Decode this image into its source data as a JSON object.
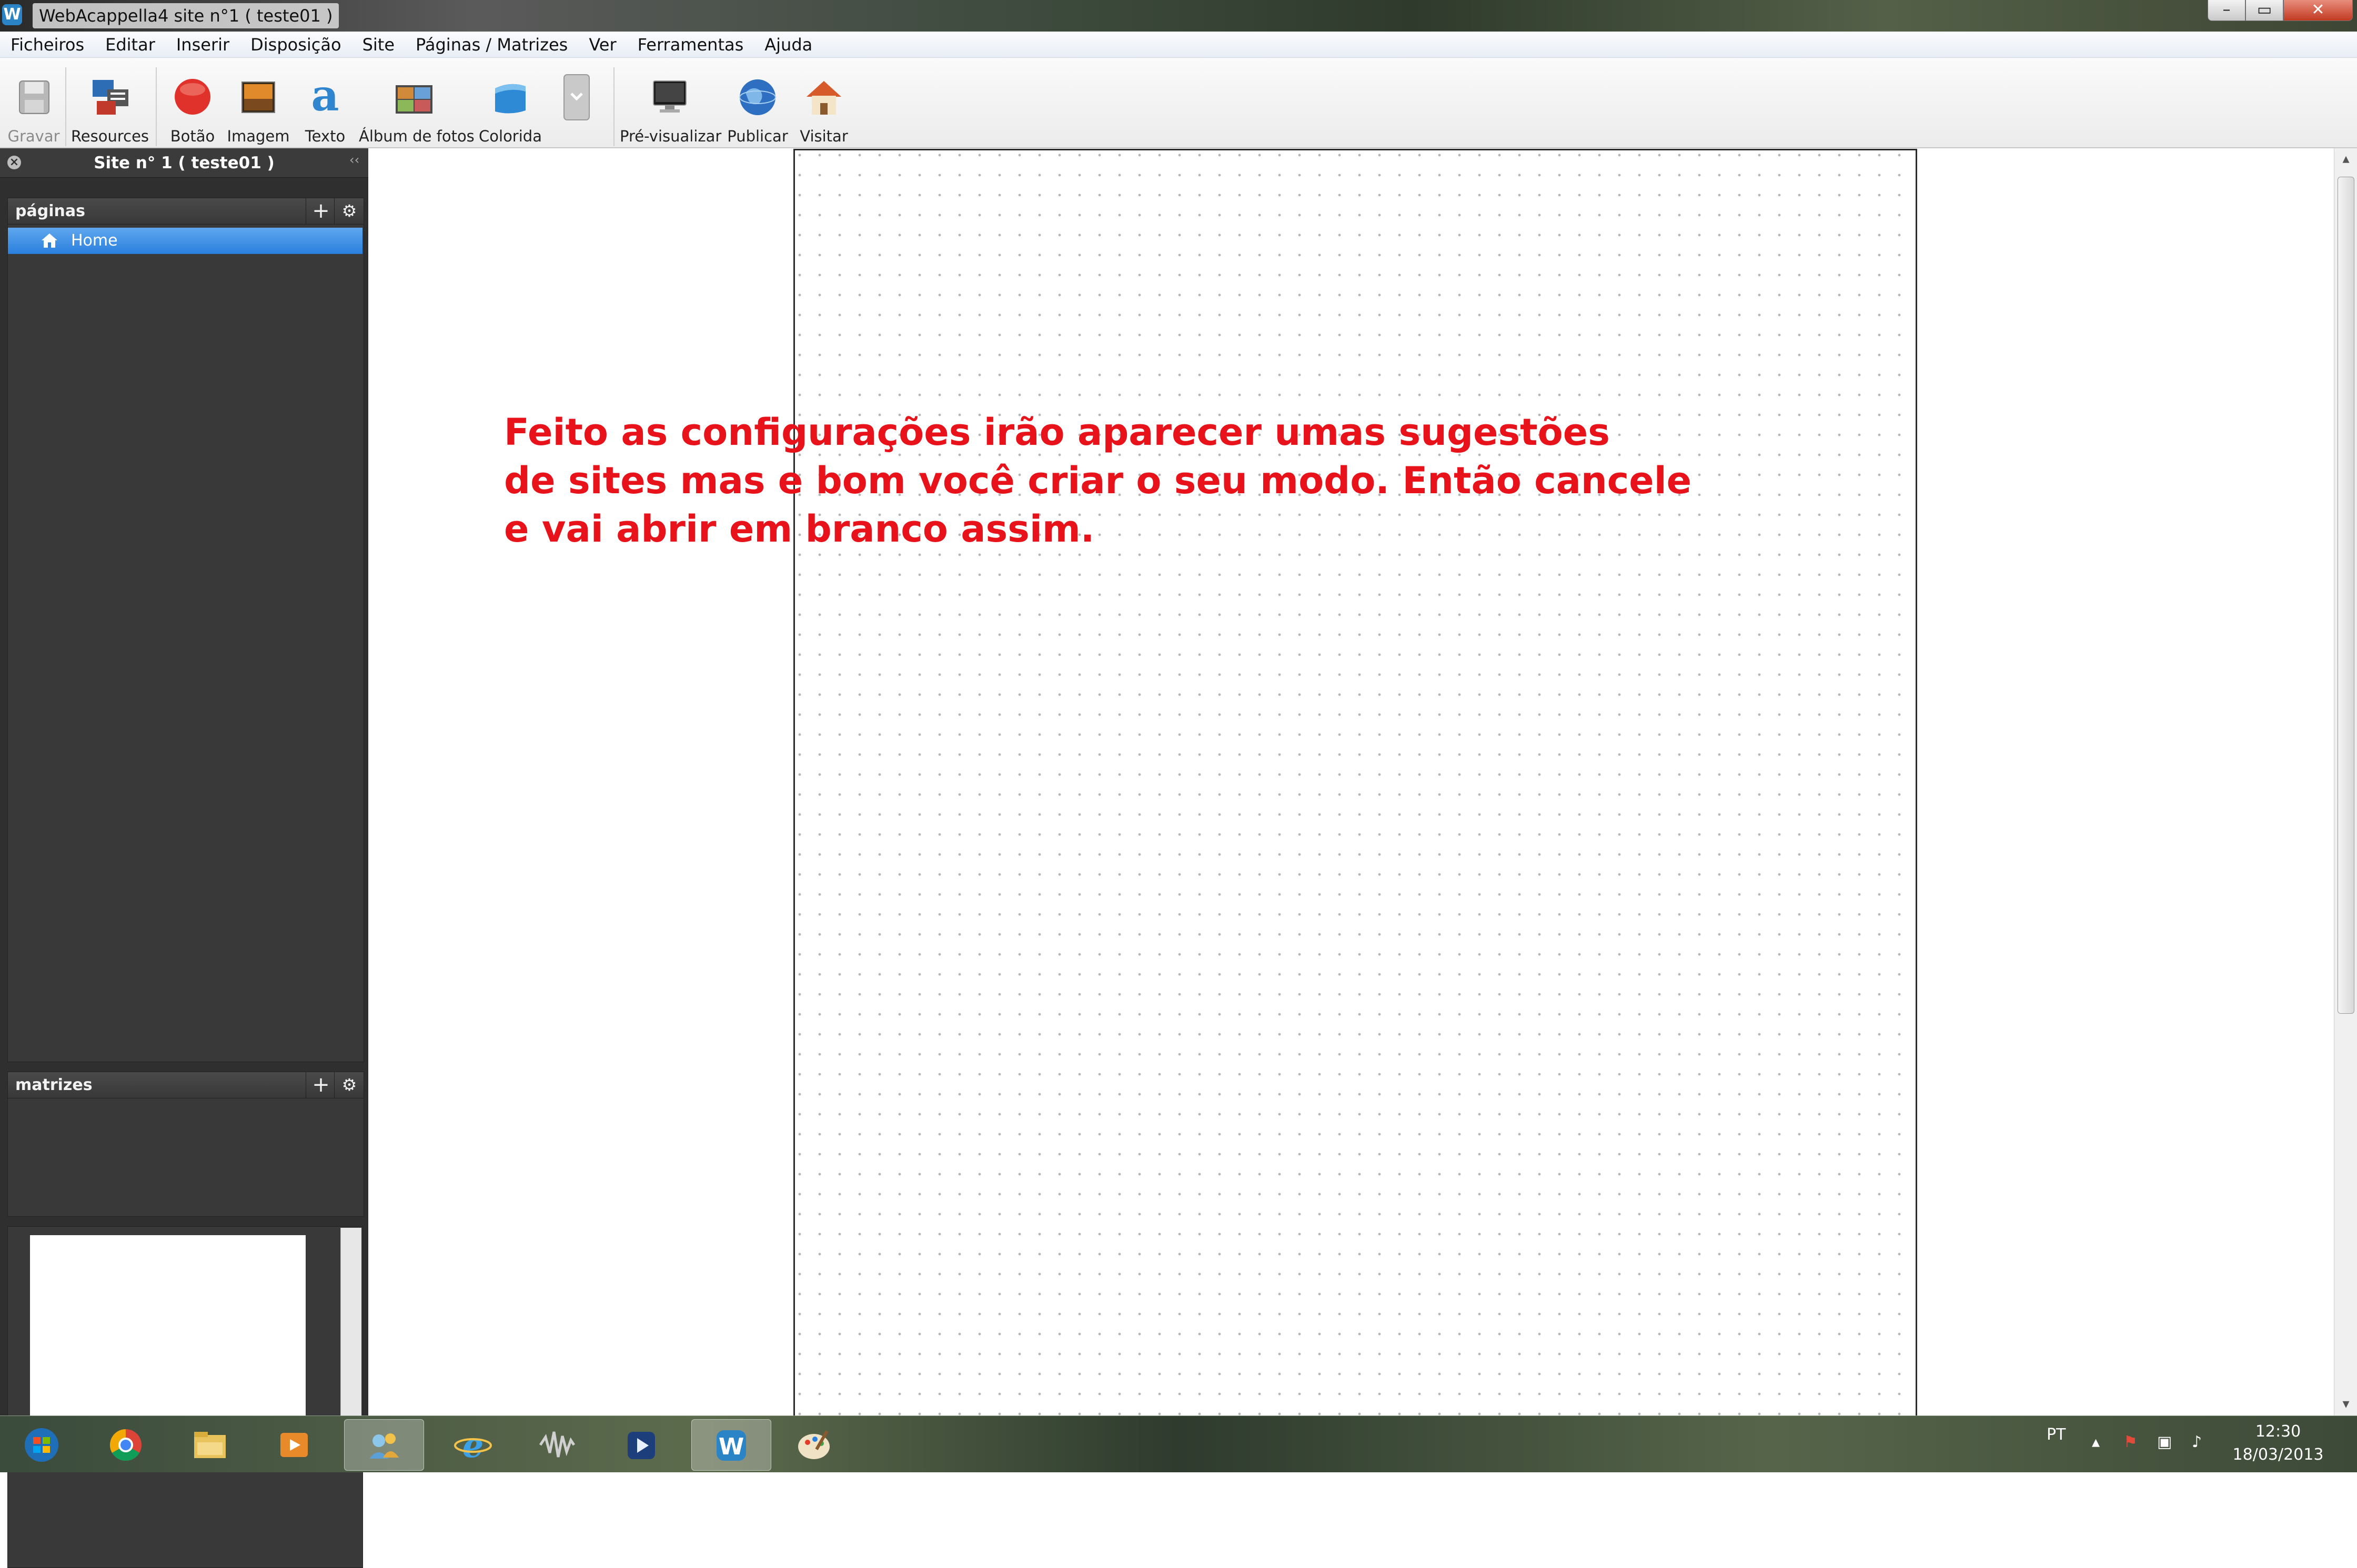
{
  "window": {
    "title": "WebAcappella4 site n°1 ( teste01 )"
  },
  "menu": [
    "Ficheiros",
    "Editar",
    "Inserir",
    "Disposição",
    "Site",
    "Páginas / Matrizes",
    "Ver",
    "Ferramentas",
    "Ajuda"
  ],
  "toolbar": {
    "gravar": "Gravar",
    "resources": "Resources",
    "botao": "Botão",
    "imagem": "Imagem",
    "texto": "Texto",
    "album": "Álbum de fotos",
    "colorida": "Colorida",
    "previsualizar": "Pré-visualizar",
    "publicar": "Publicar",
    "visitar": "Visitar"
  },
  "sidebar": {
    "site_title": "Site n° 1 ( teste01 )",
    "pages_label": "páginas",
    "pages": [
      {
        "label": "Home",
        "selected": true
      }
    ],
    "matrices_label": "matrizes"
  },
  "annotation": {
    "lines": [
      "Feito as configurações irão aparecer umas sugestões",
      "de sites mas e bom você criar o seu modo. Então cancele",
      "e vai abrir em branco assim."
    ],
    "color": "#e8121b"
  },
  "taskbar": {
    "language": "PT",
    "time": "12:30",
    "date": "18/03/2013"
  },
  "colors": {
    "selection": "#2a7fdd",
    "panel": "#2f2f2f"
  }
}
